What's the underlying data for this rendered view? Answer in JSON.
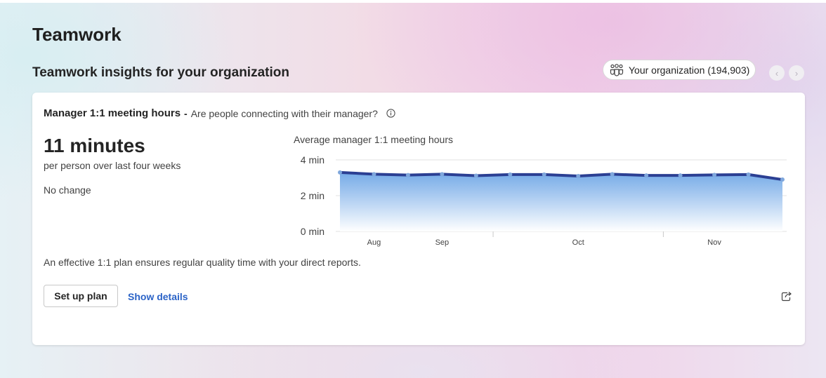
{
  "page": {
    "title": "Teamwork",
    "section_title": "Teamwork insights for your organization",
    "org_selector": "Your organization (194,903)",
    "prev_icon": "chevron-left-icon",
    "next_icon": "chevron-right-icon"
  },
  "card": {
    "metric_name": "Manager 1:1 meeting hours",
    "separator": "-",
    "question": "Are people connecting with their manager?",
    "value": "11 minutes",
    "value_description": "per person over last four weeks",
    "change": "No change",
    "footer_text": "An effective 1:1 plan ensures regular quality time with your direct reports.",
    "primary_button": "Set up plan",
    "link": "Show details",
    "share_icon": "share-icon",
    "info_icon": "info-icon"
  },
  "chart_data": {
    "type": "area",
    "title": "Average manager 1:1 meeting hours",
    "y_ticks": [
      "4 min",
      "2 min",
      "0 min"
    ],
    "ylim": [
      0,
      4
    ],
    "x_labels": [
      {
        "label": "Aug",
        "index": 1
      },
      {
        "label": "Sep",
        "index": 3
      },
      {
        "label": "Oct",
        "index": 7
      },
      {
        "label": "Nov",
        "index": 11
      }
    ],
    "series": [
      {
        "values": [
          3.3,
          3.2,
          3.15,
          3.2,
          3.12,
          3.18,
          3.18,
          3.1,
          3.2,
          3.13,
          3.13,
          3.16,
          3.18,
          2.9
        ]
      }
    ],
    "colors": {
      "line": "#2b3f93",
      "area_top": "#6ea6e6",
      "area_bottom": "#ffffff",
      "point": "#7fa7dc",
      "grid": "#e1e1e1"
    }
  }
}
